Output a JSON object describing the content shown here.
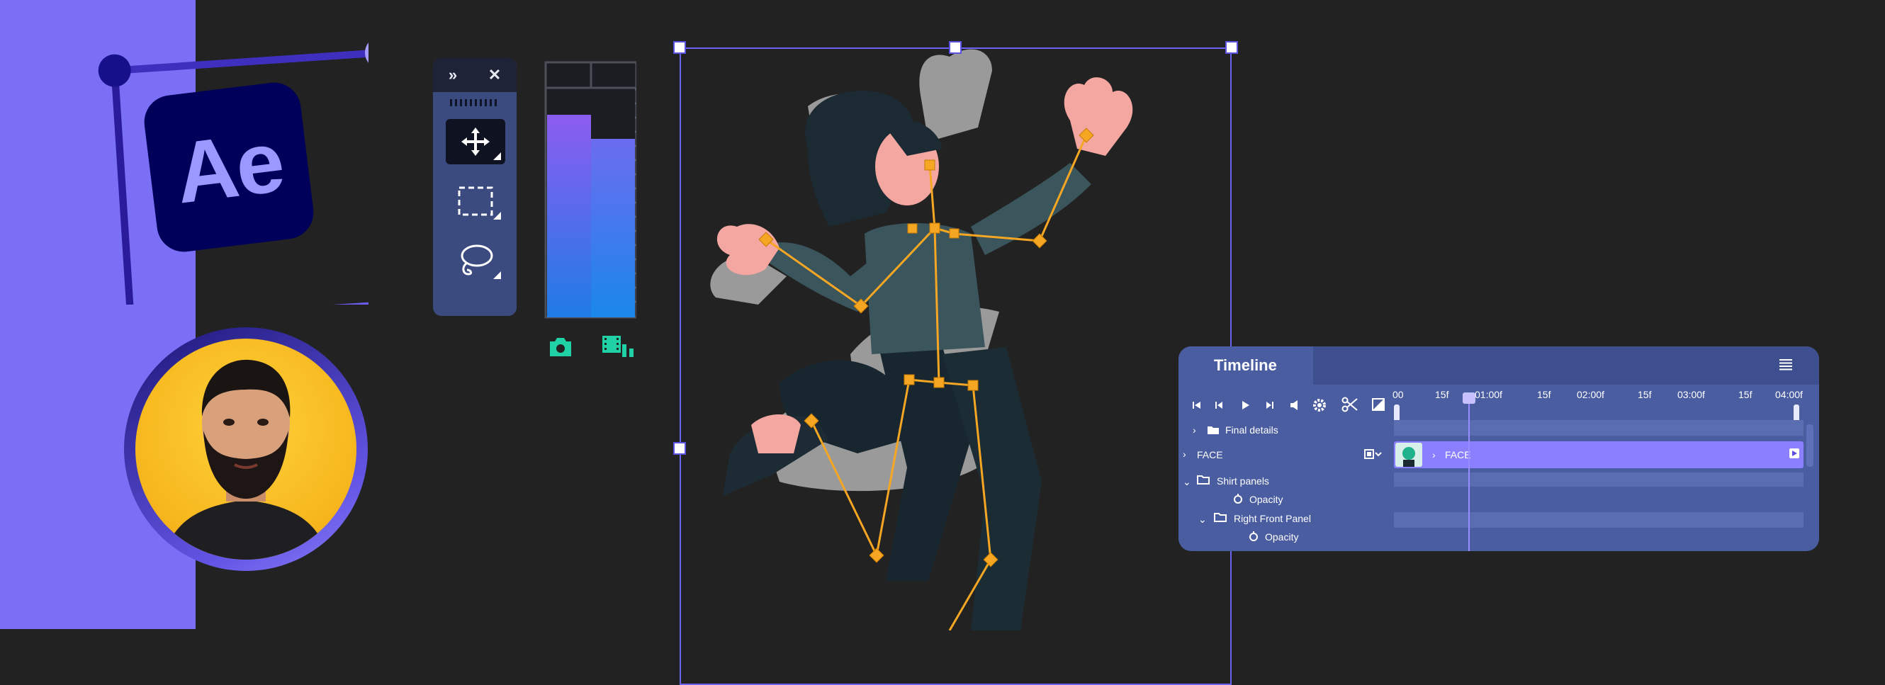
{
  "branding": {
    "logo_text": "Ae"
  },
  "tools": {
    "close_glyph": "✕",
    "expand_glyph": "»"
  },
  "timeline": {
    "title": "Timeline",
    "ruler": [
      "00",
      "15f",
      "01:00f",
      "15f",
      "02:00f",
      "15f",
      "03:00f",
      "15f",
      "04:00f"
    ],
    "layers": [
      {
        "name": "Final details",
        "kind": "folder"
      },
      {
        "name": "FACE",
        "kind": "layer"
      },
      {
        "name": "Shirt panels",
        "kind": "folder"
      },
      {
        "name": "Opacity",
        "kind": "property"
      },
      {
        "name": "Right Front Panel",
        "kind": "folder"
      },
      {
        "name": "Opacity",
        "kind": "property"
      }
    ],
    "clip_label": "FACE"
  },
  "colors": {
    "accent": "#7b6ff5",
    "logo_bg": "#00005b",
    "logo_text": "#9999ff",
    "bone": "#f5a623",
    "timeline_bg": "#4a5da0",
    "teal_icon": "#1fd1a5"
  },
  "icons": [
    "move-tool-icon",
    "marquee-tool-icon",
    "lasso-tool-icon",
    "camera-icon",
    "film-icon",
    "scissors-icon",
    "gear-icon",
    "menu-icon"
  ]
}
